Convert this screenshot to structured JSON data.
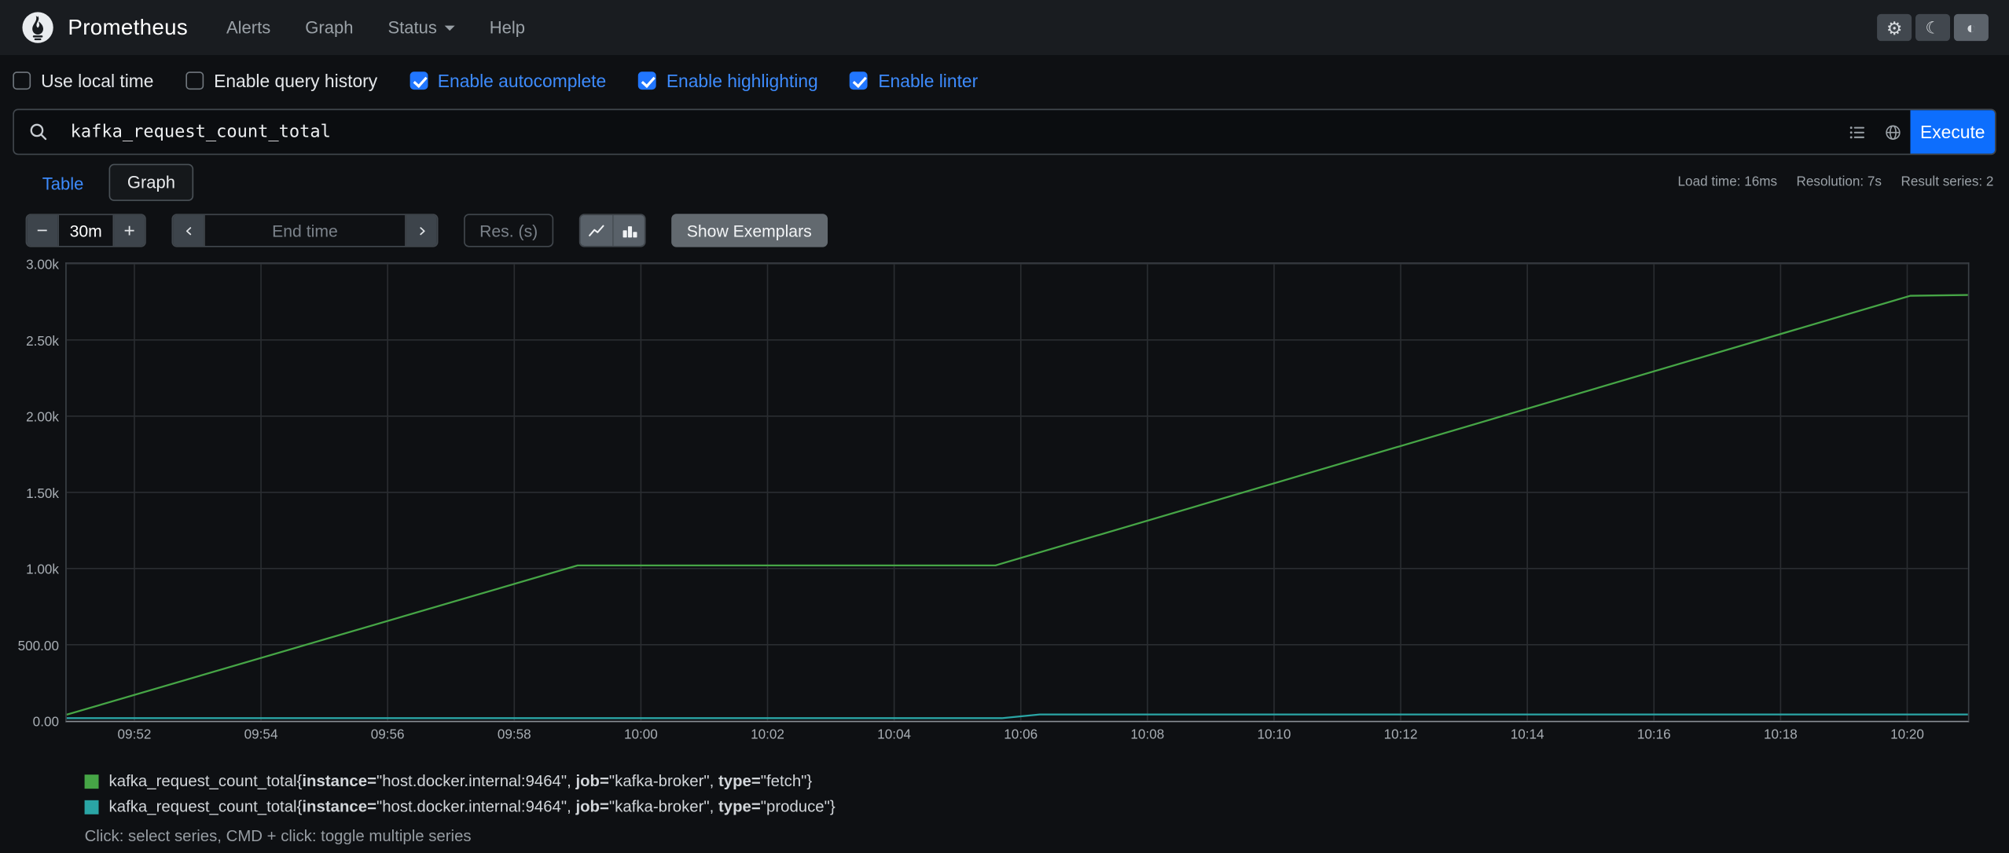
{
  "navbar": {
    "brand": "Prometheus",
    "links": [
      {
        "label": "Alerts"
      },
      {
        "label": "Graph"
      },
      {
        "label": "Status"
      },
      {
        "label": "Help"
      }
    ]
  },
  "icons": {
    "gear": "⚙",
    "moon": "☾",
    "contrast": "◐",
    "minus": "−",
    "plus": "+"
  },
  "options": {
    "checkboxes": [
      {
        "label": "Use local time",
        "checked": false
      },
      {
        "label": "Enable query history",
        "checked": false
      },
      {
        "label": "Enable autocomplete",
        "checked": true
      },
      {
        "label": "Enable highlighting",
        "checked": true
      },
      {
        "label": "Enable linter",
        "checked": true
      }
    ]
  },
  "query": {
    "value": "kafka_request_count_total",
    "execute_label": "Execute"
  },
  "tabs": {
    "table": "Table",
    "graph": "Graph",
    "active": "Graph"
  },
  "stats": {
    "load_time": "Load time: 16ms",
    "resolution": "Resolution: 7s",
    "result_series": "Result series: 2"
  },
  "controls": {
    "duration": "30m",
    "end_time_placeholder": "End time",
    "res_placeholder": "Res. (s)",
    "show_exemplars": "Show Exemplars"
  },
  "chart_data": {
    "type": "line",
    "title": "",
    "xlabel": "time",
    "ylabel": "",
    "x_unit": "minutes_of_day",
    "x_domain": [
      590.93,
      620.96
    ],
    "ylim": [
      0,
      3000
    ],
    "grid": true,
    "legend_position": "bottom",
    "x_ticks": [
      {
        "t": 592,
        "label": "09:52"
      },
      {
        "t": 594,
        "label": "09:54"
      },
      {
        "t": 596,
        "label": "09:56"
      },
      {
        "t": 598,
        "label": "09:58"
      },
      {
        "t": 600,
        "label": "10:00"
      },
      {
        "t": 602,
        "label": "10:02"
      },
      {
        "t": 604,
        "label": "10:04"
      },
      {
        "t": 606,
        "label": "10:06"
      },
      {
        "t": 608,
        "label": "10:08"
      },
      {
        "t": 610,
        "label": "10:10"
      },
      {
        "t": 612,
        "label": "10:12"
      },
      {
        "t": 614,
        "label": "10:14"
      },
      {
        "t": 616,
        "label": "10:16"
      },
      {
        "t": 618,
        "label": "10:18"
      },
      {
        "t": 620,
        "label": "10:20"
      }
    ],
    "y_ticks": [
      {
        "v": 0,
        "label": "0.00"
      },
      {
        "v": 500,
        "label": "500.00"
      },
      {
        "v": 1000,
        "label": "1.00k"
      },
      {
        "v": 1500,
        "label": "1.50k"
      },
      {
        "v": 2000,
        "label": "2.00k"
      },
      {
        "v": 2500,
        "label": "2.50k"
      },
      {
        "v": 3000,
        "label": "3.00k"
      }
    ],
    "series": [
      {
        "name": "kafka_request_count_total{instance=\"host.docker.internal:9464\", job=\"kafka-broker\", type=\"fetch\"}",
        "color": "#46a546",
        "points": [
          [
            590.93,
            40
          ],
          [
            599.0,
            1020
          ],
          [
            605.6,
            1020
          ],
          [
            620.05,
            2790
          ],
          [
            620.96,
            2795
          ]
        ]
      },
      {
        "name": "kafka_request_count_total{instance=\"host.docker.internal:9464\", job=\"kafka-broker\", type=\"produce\"}",
        "color": "#2aa5a5",
        "points": [
          [
            590.93,
            18
          ],
          [
            605.7,
            18
          ],
          [
            606.3,
            42
          ],
          [
            620.96,
            42
          ]
        ]
      }
    ]
  },
  "legend": {
    "entries": [
      {
        "parts": [
          {
            "t": "kafka_request_count_total{"
          },
          {
            "t": "instance="
          },
          {
            "t": "\"host.docker.internal:9464\", "
          },
          {
            "t": "job="
          },
          {
            "t": "\"kafka-broker\", "
          },
          {
            "t": "type="
          },
          {
            "t": "\"fetch\"}"
          }
        ]
      },
      {
        "parts": [
          {
            "t": "kafka_request_count_total{"
          },
          {
            "t": "instance="
          },
          {
            "t": "\"host.docker.internal:9464\", "
          },
          {
            "t": "job="
          },
          {
            "t": "\"kafka-broker\", "
          },
          {
            "t": "type="
          },
          {
            "t": "\"produce\"}"
          }
        ]
      }
    ],
    "hint": "Click: select series, CMD + click: toggle multiple series"
  }
}
